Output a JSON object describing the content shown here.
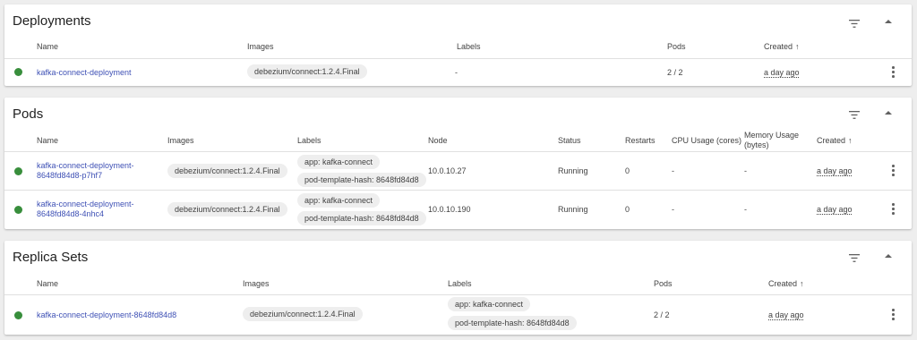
{
  "deployments": {
    "title": "Deployments",
    "headers": {
      "name": "Name",
      "images": "Images",
      "labels": "Labels",
      "pods": "Pods",
      "created": "Created"
    },
    "rows": [
      {
        "status": "running",
        "name": "kafka-connect-deployment",
        "image": "debezium/connect:1.2.4.Final",
        "labels": "-",
        "pods": "2 / 2",
        "created": "a day ago"
      }
    ]
  },
  "pods": {
    "title": "Pods",
    "headers": {
      "name": "Name",
      "images": "Images",
      "labels": "Labels",
      "node": "Node",
      "status": "Status",
      "restarts": "Restarts",
      "cpu": "CPU Usage (cores)",
      "memory_line1": "Memory Usage",
      "memory_line2": "(bytes)",
      "created": "Created"
    },
    "rows": [
      {
        "status_dot": "running",
        "name_line1": "kafka-connect-deployment-",
        "name_line2": "8648fd84d8-p7hf7",
        "image": "debezium/connect:1.2.4.Final",
        "labels": [
          "app: kafka-connect",
          "pod-template-hash: 8648fd84d8"
        ],
        "node": "10.0.10.27",
        "status": "Running",
        "restarts": "0",
        "cpu": "-",
        "memory": "-",
        "created": "a day ago"
      },
      {
        "status_dot": "running",
        "name_line1": "kafka-connect-deployment-",
        "name_line2": "8648fd84d8-4nhc4",
        "image": "debezium/connect:1.2.4.Final",
        "labels": [
          "app: kafka-connect",
          "pod-template-hash: 8648fd84d8"
        ],
        "node": "10.0.10.190",
        "status": "Running",
        "restarts": "0",
        "cpu": "-",
        "memory": "-",
        "created": "a day ago"
      }
    ]
  },
  "replica_sets": {
    "title": "Replica Sets",
    "headers": {
      "name": "Name",
      "images": "Images",
      "labels": "Labels",
      "pods": "Pods",
      "created": "Created"
    },
    "rows": [
      {
        "status": "running",
        "name": "kafka-connect-deployment-8648fd84d8",
        "image": "debezium/connect:1.2.4.Final",
        "labels": [
          "app: kafka-connect",
          "pod-template-hash: 8648fd84d8"
        ],
        "pods": "2 / 2",
        "created": "a day ago"
      }
    ]
  },
  "icons": {
    "filter": "filter-list-icon",
    "collapse": "collapse-up-icon",
    "menu": "more-vert-icon",
    "sort": "arrow-upward-icon"
  },
  "colors": {
    "link": "#3f51b5",
    "status_ok": "#388e3c",
    "background": "#eeeeee"
  },
  "sort_arrow": "↑"
}
